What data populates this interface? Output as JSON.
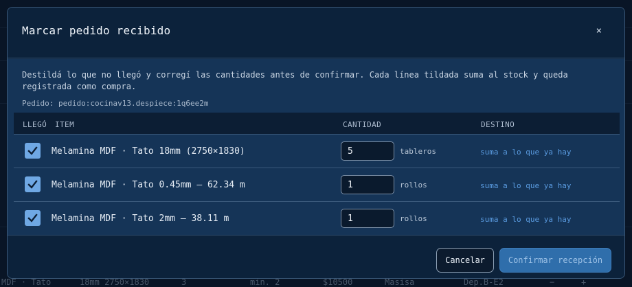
{
  "background": {
    "bottom_row": {
      "item": "MDF · Tato",
      "dims": "18mm 2750×1830",
      "qty": "3",
      "min": "min. 2",
      "price": "$10500",
      "supplier": "Masisa",
      "location": "Dep.B-E2",
      "minus": "−",
      "plus": "+"
    }
  },
  "modal": {
    "title": "Marcar pedido recibido",
    "close_glyph": "×",
    "intro": "Destildá lo que no llegó y corregí las cantidades antes de confirmar. Cada línea tildada suma al stock y queda registrada como compra.",
    "order_ref": "Pedido: pedido:cocinav13.despiece:1q6ee2m",
    "columns": {
      "arrived": "LLEGÓ",
      "item": "ITEM",
      "quantity": "CANTIDAD",
      "destination": "DESTINO"
    },
    "rows": [
      {
        "checked": true,
        "item": "Melamina MDF · Tato 18mm (2750×1830)",
        "quantity": "5",
        "unit": "tableros",
        "destination": "suma a lo que ya hay"
      },
      {
        "checked": true,
        "item": "Melamina MDF · Tato 0.45mm — 62.34 m",
        "quantity": "1",
        "unit": "rollos",
        "destination": "suma a lo que ya hay"
      },
      {
        "checked": true,
        "item": "Melamina MDF · Tato 2mm — 38.11 m",
        "quantity": "1",
        "unit": "rollos",
        "destination": "suma a lo que ya hay"
      }
    ],
    "buttons": {
      "cancel": "Cancelar",
      "confirm": "Confirmar recepción"
    }
  }
}
